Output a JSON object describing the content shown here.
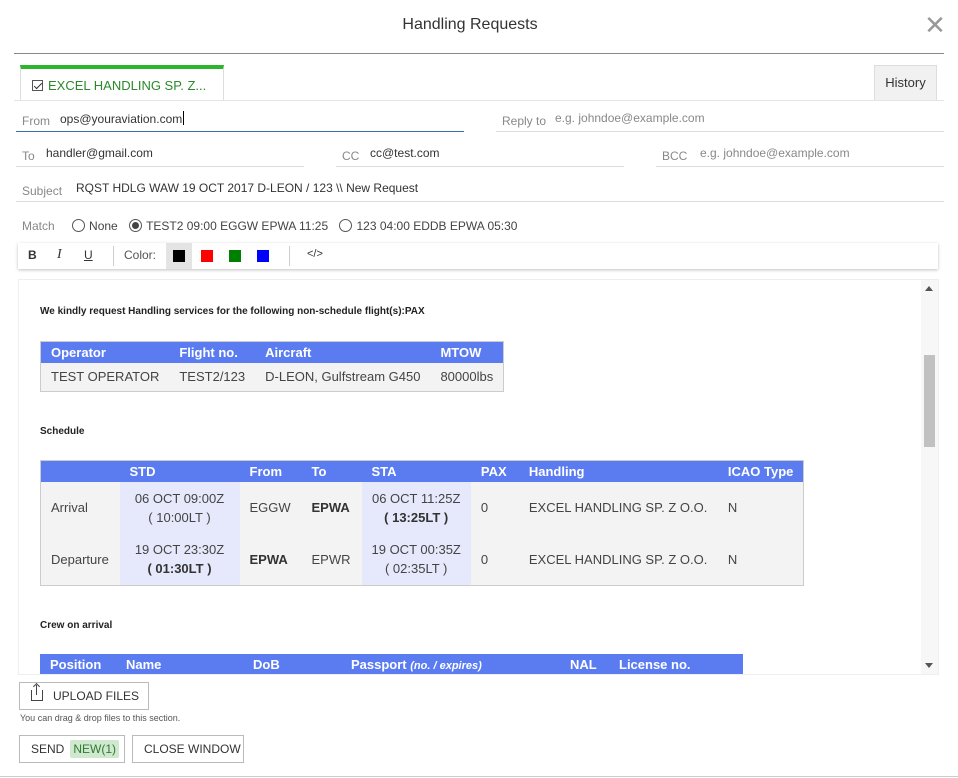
{
  "dialog": {
    "title": "Handling Requests",
    "close_icon": "close-icon"
  },
  "tabs": [
    {
      "label": "EXCEL HANDLING SP. Z...",
      "checked": true
    }
  ],
  "history_label": "History",
  "form": {
    "from": {
      "label": "From",
      "value": "ops@youraviation.com"
    },
    "reply_to": {
      "label": "Reply to",
      "placeholder": "e.g. johndoe@example.com"
    },
    "to": {
      "label": "To",
      "value": "handler@gmail.com"
    },
    "cc": {
      "label": "CC",
      "value": "cc@test.com"
    },
    "bcc": {
      "label": "BCC",
      "placeholder": "e.g. johndoe@example.com"
    },
    "subject": {
      "label": "Subject",
      "value": "RQST HDLG  WAW 19 OCT 2017  D-LEON / 123 \\\\ New Request"
    }
  },
  "match": {
    "label": "Match",
    "options": [
      {
        "label": "None",
        "selected": false
      },
      {
        "label": "TEST2 09:00 EGGW EPWA 11:25",
        "selected": true
      },
      {
        "label": "123 04:00 EDDB EPWA 05:30",
        "selected": false
      }
    ]
  },
  "toolbar": {
    "bold": "B",
    "italic": "I",
    "underline": "U",
    "color_label": "Color:",
    "colors": [
      "#000000",
      "#ff0000",
      "#008000",
      "#0000ff"
    ],
    "code": "</>"
  },
  "email_body": {
    "intro": "We kindly request Handling services for the following non-schedule flight(s):PAX",
    "flight_table": {
      "headers": [
        "Operator",
        "Flight no.",
        "Aircraft",
        "MTOW"
      ],
      "rows": [
        [
          "TEST OPERATOR",
          "TEST2/123",
          "D-LEON, Gulfstream G450",
          "80000lbs"
        ]
      ]
    },
    "schedule_title": "Schedule",
    "schedule_table": {
      "headers": [
        "",
        "STD",
        "From",
        "To",
        "STA",
        "PAX",
        "Handling",
        "ICAO Type"
      ],
      "rows": [
        {
          "type": "Arrival",
          "std": "06 OCT 09:00Z",
          "std_lt": "( 10:00LT )",
          "from": "EGGW",
          "to": "EPWA",
          "sta": "06 OCT 11:25Z",
          "sta_lt": "( 13:25LT )",
          "pax": "0",
          "handling": "EXCEL HANDLING SP. Z O.O.",
          "icao": "N"
        },
        {
          "type": "Departure",
          "std": "19 OCT 23:30Z",
          "std_lt": "( 01:30LT )",
          "from": "EPWA",
          "to": "EPWR",
          "sta": "19 OCT 00:35Z",
          "sta_lt": "( 02:35LT )",
          "pax": "0",
          "handling": "EXCEL HANDLING SP. Z O.O.",
          "icao": "N"
        }
      ]
    },
    "crew_title": "Crew on arrival",
    "crew_table": {
      "headers": [
        "Position",
        "Name",
        "DoB",
        "Passport",
        "(no. / expires)",
        "NAL",
        "License no."
      ]
    }
  },
  "upload": {
    "label": "UPLOAD FILES",
    "hint": "You can drag & drop files to this section."
  },
  "actions": {
    "send": "SEND",
    "send_badge": "NEW(1)",
    "close": "CLOSE WINDOW"
  }
}
